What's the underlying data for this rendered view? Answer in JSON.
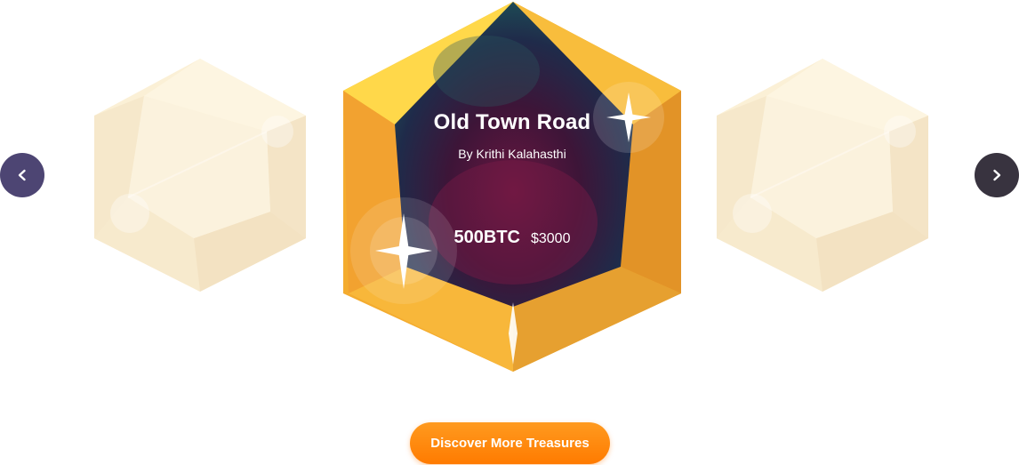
{
  "carousel": {
    "active_card": {
      "title": "Old Town Road",
      "author": "By Krithi Kalahasthi",
      "price_btc": "500BTC",
      "price_usd": "$3000"
    },
    "prev_icon": "chevron-left-icon",
    "next_icon": "chevron-right-icon"
  },
  "cta": {
    "label": "Discover More Treasures"
  },
  "colors": {
    "gem_gold": "#f7b733",
    "gem_gold_dark": "#e39a2a",
    "gem_pale": "#fbefd3",
    "artwork_dark": "#23163a",
    "artwork_magenta": "#6a1640",
    "nav_prev": "#4d4573",
    "nav_next": "#38333f",
    "cta": "#ff8a00"
  }
}
